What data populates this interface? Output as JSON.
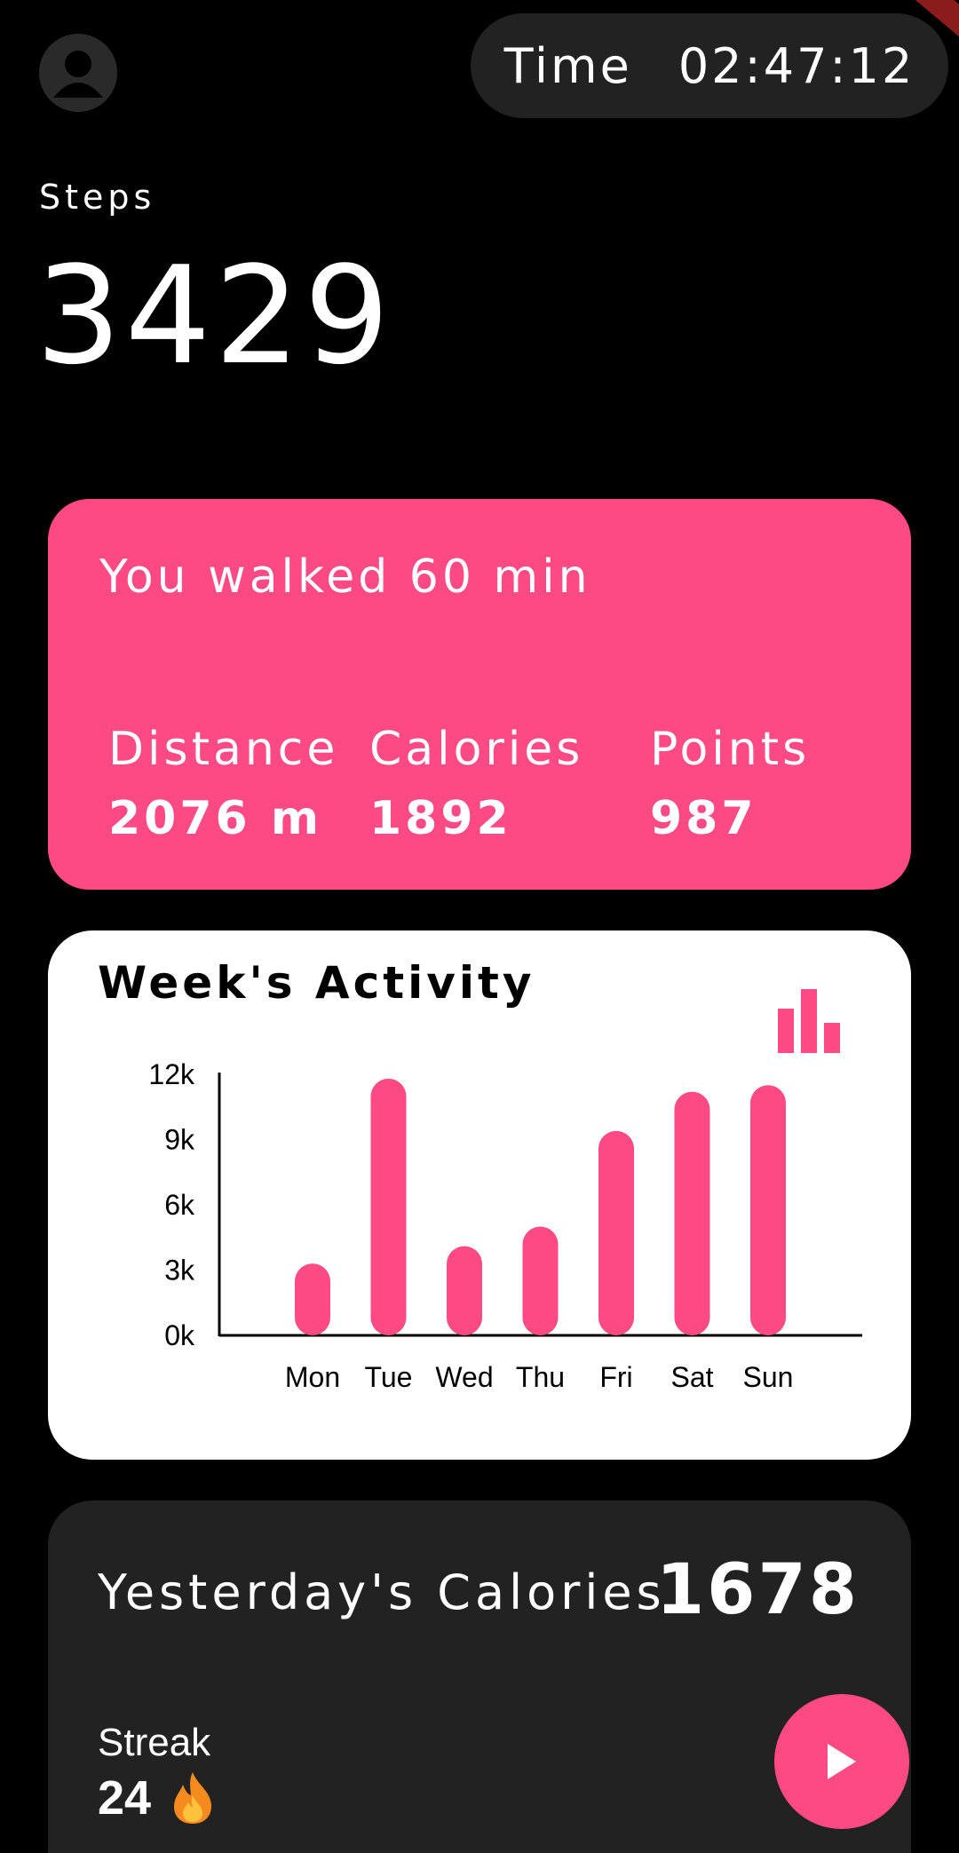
{
  "header": {
    "time_label": "Time",
    "time_value": "02:47:12"
  },
  "steps": {
    "label": "Steps",
    "value": "3429"
  },
  "walk_card": {
    "title": "You walked 60 min",
    "stats": [
      {
        "label": "Distance",
        "value": "2076 m"
      },
      {
        "label": "Calories",
        "value": "1892"
      },
      {
        "label": "Points",
        "value": "987"
      }
    ]
  },
  "activity": {
    "title": "Week's Activity",
    "icon": "bar-chart-icon"
  },
  "chart_data": {
    "type": "bar",
    "categories": [
      "Mon",
      "Tue",
      "Wed",
      "Thu",
      "Fri",
      "Sat",
      "Sun"
    ],
    "values": [
      3300,
      11800,
      4100,
      5000,
      9400,
      11200,
      11500
    ],
    "ylim": [
      0,
      12000
    ],
    "ytick_values": [
      0,
      3000,
      6000,
      9000,
      12000
    ],
    "yticks": [
      "0k",
      "3k",
      "6k",
      "9k",
      "12k"
    ],
    "bar_color": "#fe4a84",
    "grid": false
  },
  "calories": {
    "label": "Yesterday's Calories",
    "value": "1678"
  },
  "streak": {
    "label": "Streak",
    "value": "24",
    "icon": "fire-icon"
  },
  "fab": {
    "icon": "play-icon"
  },
  "colors": {
    "accent": "#fe4a84",
    "background": "#000000",
    "card_dark": "#222222"
  }
}
